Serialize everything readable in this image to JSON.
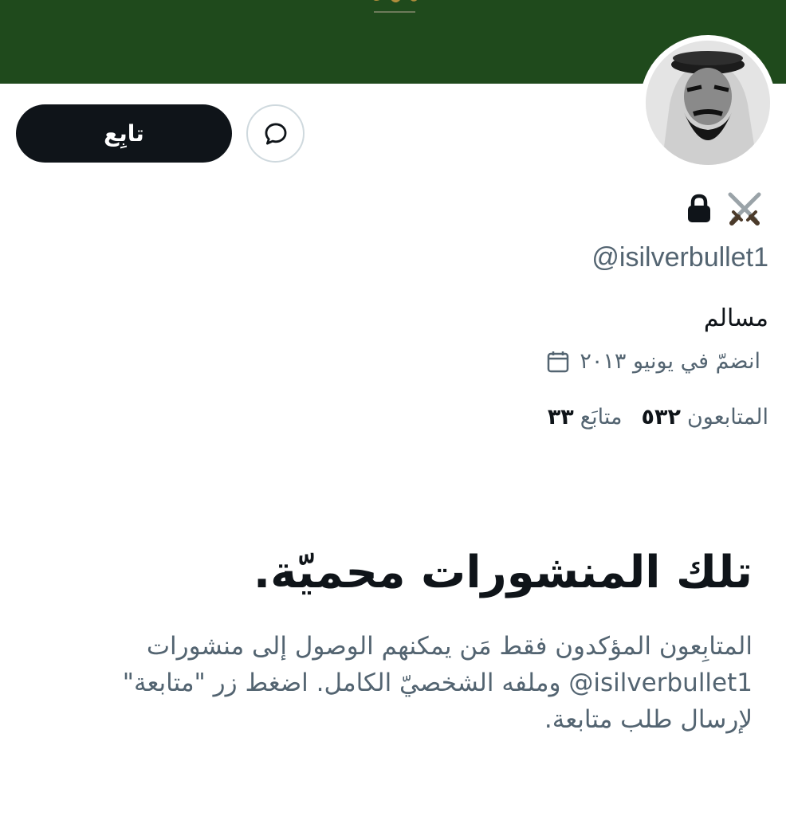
{
  "profile": {
    "display_name_icons": [
      "crossed-swords-icon",
      "lock-icon"
    ],
    "handle": "@isilverbullet1",
    "bio": "مسالم",
    "joined": "انضمّ في يونيو ٢٠١٣",
    "following_count": "٣٣",
    "following_label": "متابَع",
    "followers_count": "٥٣٢",
    "followers_label": "المتابعون"
  },
  "actions": {
    "follow_label": "تابِع",
    "message_icon": "message-icon"
  },
  "protected": {
    "title": "تلك المنشورات محميّة.",
    "description": "المتابِعون المؤكدون فقط مَن يمكنهم الوصول إلى منشورات ‎@isilverbullet1‎ وملفه الشخصيّ الكامل. اضغط زر \"متابعة\" لإرسال طلب متابعة."
  },
  "colors": {
    "banner": "#1f4a1c",
    "primary_text": "#0f1419",
    "secondary_text": "#536471",
    "button_dark": "#0f1419"
  }
}
